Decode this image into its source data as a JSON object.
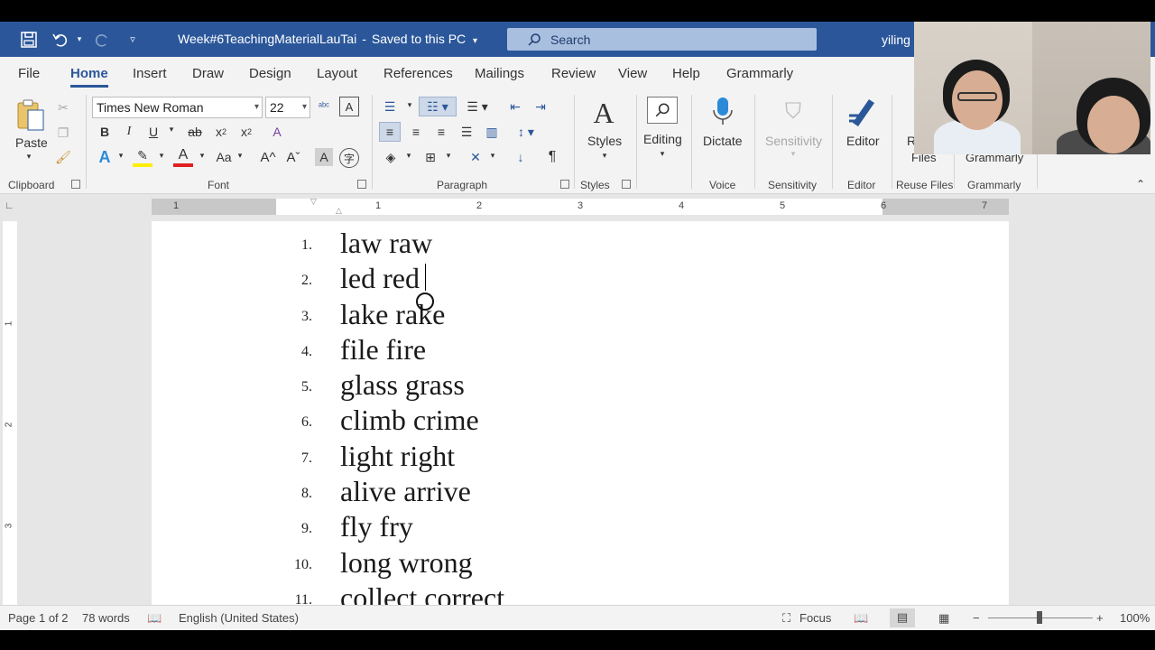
{
  "titlebar": {
    "document_name": "Week#6TeachingMaterialLauTai",
    "save_status": "Saved to this PC",
    "search_placeholder": "Search",
    "user": "yiling"
  },
  "menu": {
    "tabs": [
      "File",
      "Home",
      "Insert",
      "Draw",
      "Design",
      "Layout",
      "References",
      "Mailings",
      "Review",
      "View",
      "Help",
      "Grammarly"
    ],
    "active": "Home"
  },
  "ribbon": {
    "clipboard": {
      "paste": "Paste",
      "group": "Clipboard"
    },
    "font": {
      "family": "Times New Roman",
      "size": "22",
      "group": "Font",
      "change_case": "Aa"
    },
    "paragraph": {
      "group": "Paragraph"
    },
    "styles": {
      "label": "Styles",
      "group": "Styles"
    },
    "editing": {
      "label": "Editing"
    },
    "voice": {
      "label": "Dictate",
      "group": "Voice"
    },
    "sensitivity": {
      "label": "Sensitivity",
      "group": "Sensitivity"
    },
    "editor": {
      "label": "Editor",
      "group": "Editor"
    },
    "reuse": {
      "label_part": "R",
      "files": "Files",
      "group": "Reuse Files"
    },
    "grammarly": {
      "label": "Grammarly",
      "group": "Grammarly"
    }
  },
  "ruler": {
    "h_numbers": [
      "1",
      "1",
      "2",
      "3",
      "4",
      "5",
      "6",
      "7"
    ],
    "v_numbers": [
      "1",
      "2",
      "3"
    ]
  },
  "document": {
    "items": [
      {
        "num": "1.",
        "text": "law raw"
      },
      {
        "num": "2.",
        "text": "led red"
      },
      {
        "num": "3.",
        "text": "lake rake"
      },
      {
        "num": "4.",
        "text": "file fire"
      },
      {
        "num": "5.",
        "text": "glass grass"
      },
      {
        "num": "6.",
        "text": "climb crime"
      },
      {
        "num": "7.",
        "text": "light right"
      },
      {
        "num": "8.",
        "text": "alive arrive"
      },
      {
        "num": "9.",
        "text": "fly fry"
      },
      {
        "num": "10.",
        "text": "long wrong"
      },
      {
        "num": "11.",
        "text": "collect correct"
      }
    ]
  },
  "statusbar": {
    "page": "Page 1 of 2",
    "words": "78 words",
    "language": "English (United States)",
    "focus": "Focus",
    "zoom": "100%"
  },
  "colors": {
    "accent": "#2b579a",
    "ribbon_bg": "#f3f3f3",
    "doc_bg": "#e6e6e6"
  }
}
